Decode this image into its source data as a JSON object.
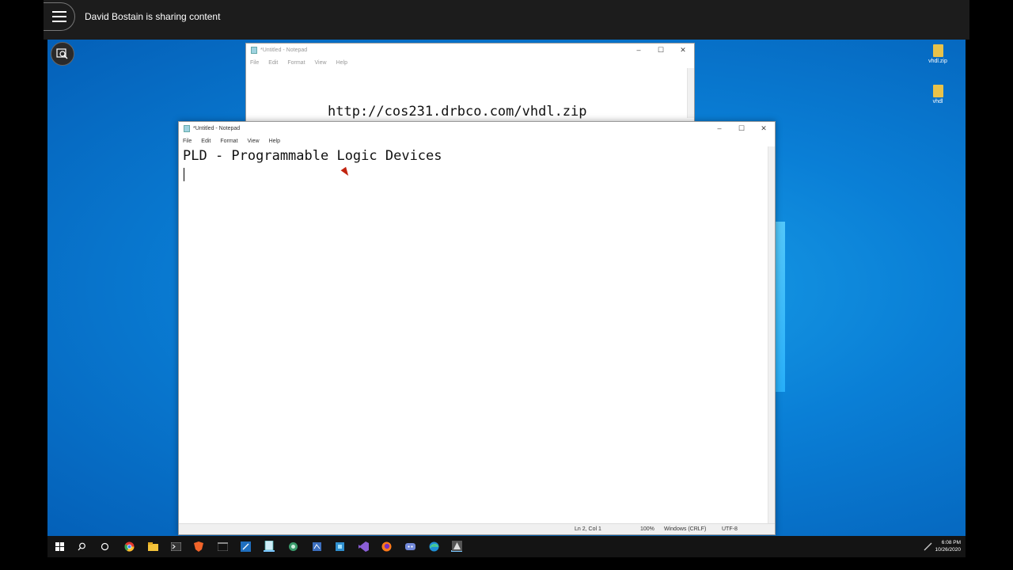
{
  "meeting": {
    "sharing_text": "David Bostain is sharing content"
  },
  "desktop": {
    "icons": [
      {
        "label": "vhdl.zip"
      },
      {
        "label": "vhdl"
      }
    ]
  },
  "notepad_back": {
    "title": "*Untitled - Notepad",
    "menu": [
      "File",
      "Edit",
      "Format",
      "View",
      "Help"
    ],
    "content": "http://cos231.drbco.com/vhdl.zip"
  },
  "notepad_front": {
    "title": "*Untitled - Notepad",
    "menu": [
      "File",
      "Edit",
      "Format",
      "View",
      "Help"
    ],
    "content": "PLD - Programmable Logic Devices",
    "status": {
      "position": "Ln 2, Col 1",
      "zoom": "100%",
      "line_ending": "Windows (CRLF)",
      "encoding": "UTF-8"
    },
    "controls": {
      "minimize": "–",
      "maximize": "☐",
      "close": "✕"
    }
  },
  "taskbar": {
    "icons": [
      "windows-start-icon",
      "search-icon",
      "cortana-icon",
      "chrome-icon",
      "file-explorer-icon",
      "terminal-icon",
      "brave-icon",
      "cmd-icon",
      "snipping-tool-icon",
      "notepad-icon",
      "app-icon-1",
      "app-icon-2",
      "app-icon-3",
      "visual-studio-icon",
      "firefox-icon",
      "discord-icon",
      "edge-icon",
      "app-icon-4"
    ],
    "time": "6:08 PM",
    "date": "10/26/2020"
  }
}
